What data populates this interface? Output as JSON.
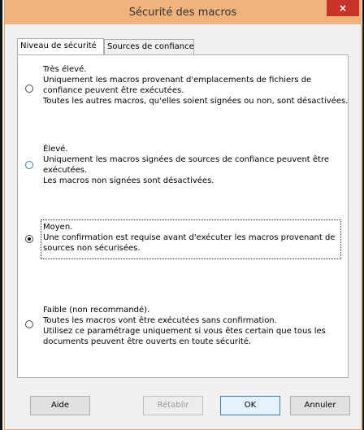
{
  "window": {
    "title": "Sécurité des macros",
    "close_glyph": "×"
  },
  "tabs": [
    {
      "label": "Niveau de sécurité",
      "active": true
    },
    {
      "label": "Sources de confiance",
      "active": false
    }
  ],
  "options": [
    {
      "title": "Très élevé.",
      "lines": [
        "Uniquement les macros provenant d'emplacements de fichiers de",
        "confiance peuvent être exécutées.",
        "Toutes les autres macros, qu'elles soient signées ou non, sont désactivées."
      ],
      "selected": false
    },
    {
      "title": "Élevé.",
      "lines": [
        "Uniquement les macros signées de sources de confiance peuvent être",
        "exécutées.",
        "Les macros non signées sont désactivées."
      ],
      "selected": false
    },
    {
      "title": "Moyen.",
      "lines": [
        "Une confirmation est requise avant d'exécuter les macros provenant de",
        "sources non sécurisées."
      ],
      "selected": true
    },
    {
      "title": "Faible (non recommandé).",
      "lines": [
        "Toutes les macros vont être exécutées sans confirmation.",
        "Utilisez ce paramétrage uniquement si vous êtes certain que tous les",
        "documents peuvent être ouverts en toute sécurité."
      ],
      "selected": false
    }
  ],
  "buttons": {
    "help": "Aide",
    "reset": "Rétablir",
    "ok": "OK",
    "cancel": "Annuler"
  }
}
